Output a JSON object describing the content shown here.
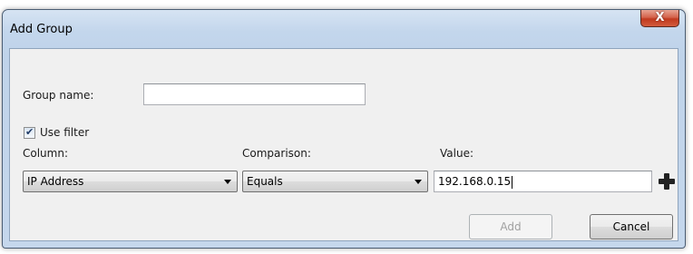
{
  "window": {
    "title": "Add Group",
    "close_label": "X"
  },
  "form": {
    "group_name_label": "Group name:",
    "group_name_value": "",
    "use_filter_label": "Use filter",
    "use_filter_checked": true,
    "column_label": "Column:",
    "comparison_label": "Comparison:",
    "value_label": "Value:",
    "column_selected": "IP Address",
    "comparison_selected": "Equals",
    "value_text": "192.168.0.15"
  },
  "buttons": {
    "add_label": "Add",
    "cancel_label": "Cancel",
    "add_filter_icon": "plus-icon"
  }
}
